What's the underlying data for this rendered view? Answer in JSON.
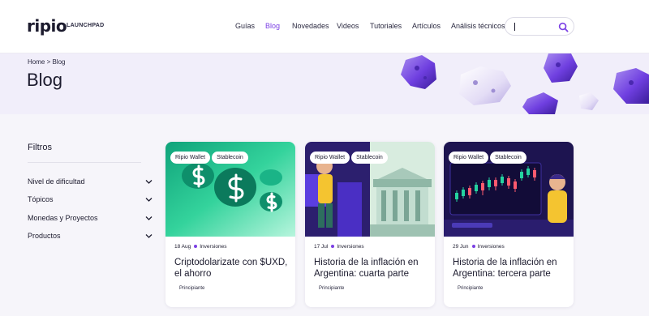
{
  "header": {
    "logo": "ripio",
    "logo_sub": "LAUNCHPAD",
    "nav": [
      "Guías",
      "Blog",
      "Novedades",
      "Videos",
      "Tutoriales",
      "Artículos",
      "Análisis técnicos"
    ],
    "active_nav": "Blog",
    "search": {
      "value": "",
      "placeholder": ""
    }
  },
  "hero": {
    "breadcrumb": "Home > Blog",
    "title": "Blog"
  },
  "filters": {
    "title": "Filtros",
    "items": [
      "Nivel de dificultad",
      "Tópicos",
      "Monedas y Proyectos",
      "Productos"
    ]
  },
  "cards": [
    {
      "tags": [
        "Ripio Wallet",
        "Stablecoin"
      ],
      "date": "18 Aug",
      "category": "Inversiones",
      "title": "Criptodolarizate con $UXD, el ahorro",
      "level": "Principiante"
    },
    {
      "tags": [
        "Ripio Wallet",
        "Stablecoin"
      ],
      "date": "17 Jul",
      "category": "Inversiones",
      "title": "Historia de la inflación en Argentina: cuarta parte",
      "level": "Principiante"
    },
    {
      "tags": [
        "Ripio Wallet",
        "Stablecoin"
      ],
      "date": "29 Jun",
      "category": "Inversiones",
      "title": "Historia de la inflación en Argentina: tercera parte",
      "level": "Principiante"
    }
  ],
  "colors": {
    "accent": "#7b3fe4",
    "hero_bg": "#f1eefa",
    "page_bg": "#f6f5fa"
  }
}
